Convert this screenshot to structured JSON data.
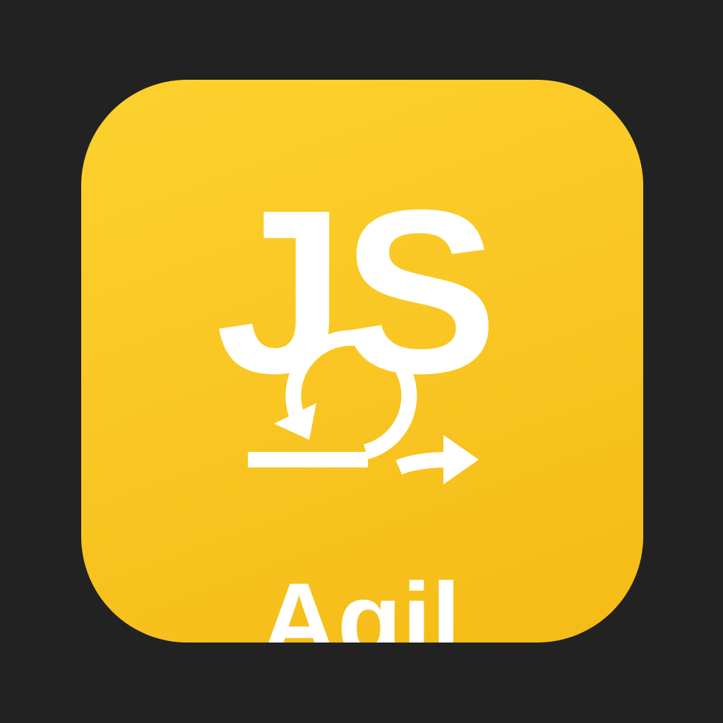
{
  "icon": {
    "title_top": "JS",
    "title_bottom": "Agil",
    "symbol": "agile-cycle-arrow-icon",
    "colors": {
      "background": "#222222",
      "tile": "#f9c623",
      "foreground": "#ffffff"
    }
  }
}
